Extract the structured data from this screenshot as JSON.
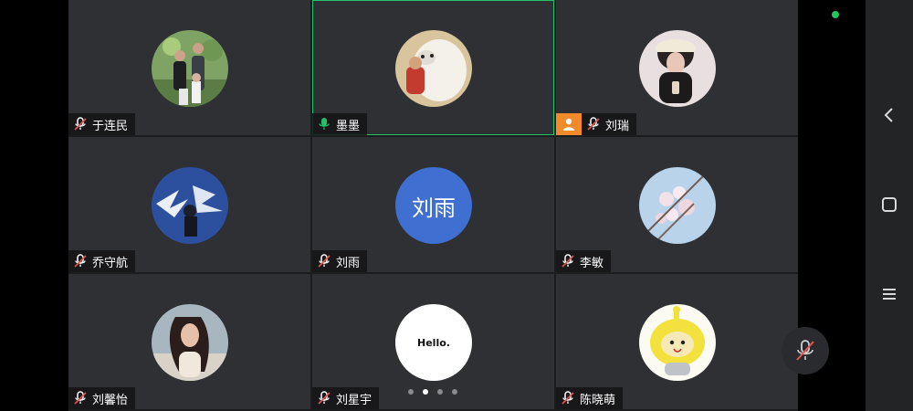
{
  "participants": [
    {
      "name": "于连民",
      "mic": "muted",
      "avatar": {
        "kind": "photo-family"
      }
    },
    {
      "name": "墨墨",
      "mic": "active",
      "avatar": {
        "kind": "photo-robot"
      },
      "speaking": true
    },
    {
      "name": "刘瑞",
      "mic": "muted",
      "avatar": {
        "kind": "photo-girl-hat"
      },
      "host": true
    },
    {
      "name": "乔守航",
      "mic": "muted",
      "avatar": {
        "kind": "photo-blue-art"
      }
    },
    {
      "name": "刘雨",
      "mic": "muted",
      "avatar": {
        "kind": "text",
        "text": "刘雨",
        "bg": "#3f6fd0",
        "fg": "#ffffff"
      }
    },
    {
      "name": "李敏",
      "mic": "muted",
      "avatar": {
        "kind": "photo-blossom"
      }
    },
    {
      "name": "刘馨怡",
      "mic": "muted",
      "avatar": {
        "kind": "photo-portrait-sea"
      }
    },
    {
      "name": "刘星宇",
      "mic": "muted",
      "avatar": {
        "kind": "text",
        "text": "Hello.",
        "bg": "#ffffff",
        "fg": "#111111"
      }
    },
    {
      "name": "陈晓萌",
      "mic": "muted",
      "avatar": {
        "kind": "photo-cartoon-yellow"
      }
    }
  ],
  "pager": {
    "pages": 4,
    "current": 2
  },
  "colors": {
    "active_border": "#23c16b",
    "host_badge": "#f08a2a",
    "status_dot": "#22c55e",
    "muted_icon": "#ffffff",
    "muted_slash": "#e25555"
  },
  "icons": {
    "muted": "mic-off-icon",
    "active": "mic-icon",
    "host": "host-person-icon",
    "nav_back": "back-icon",
    "nav_home": "home-icon",
    "nav_menu": "menu-icon"
  }
}
